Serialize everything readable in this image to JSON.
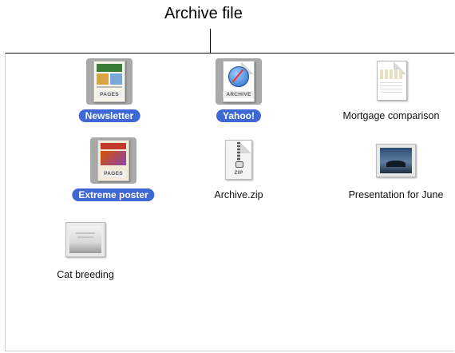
{
  "callout": {
    "label": "Archive file"
  },
  "items": [
    {
      "label": "Newsletter",
      "selected": true,
      "icon": "pages-document-icon",
      "badge": "PAGES"
    },
    {
      "label": "Yahoo!",
      "selected": true,
      "icon": "safari-webarchive-icon",
      "badge": "ARCHIVE"
    },
    {
      "label": "Mortgage comparison",
      "selected": false,
      "icon": "numbers-spreadsheet-icon"
    },
    {
      "label": "Extreme poster",
      "selected": true,
      "icon": "pages-document-icon",
      "badge": "PAGES"
    },
    {
      "label": "Archive.zip",
      "selected": false,
      "icon": "zip-archive-icon",
      "badge": "ZIP"
    },
    {
      "label": "Presentation for June",
      "selected": false,
      "icon": "keynote-presentation-icon"
    },
    {
      "label": "Cat breeding",
      "selected": false,
      "icon": "keynote-presentation-icon"
    }
  ],
  "colors": {
    "selection": "#3f67d6",
    "icon_selection": "#a9a9a9"
  }
}
